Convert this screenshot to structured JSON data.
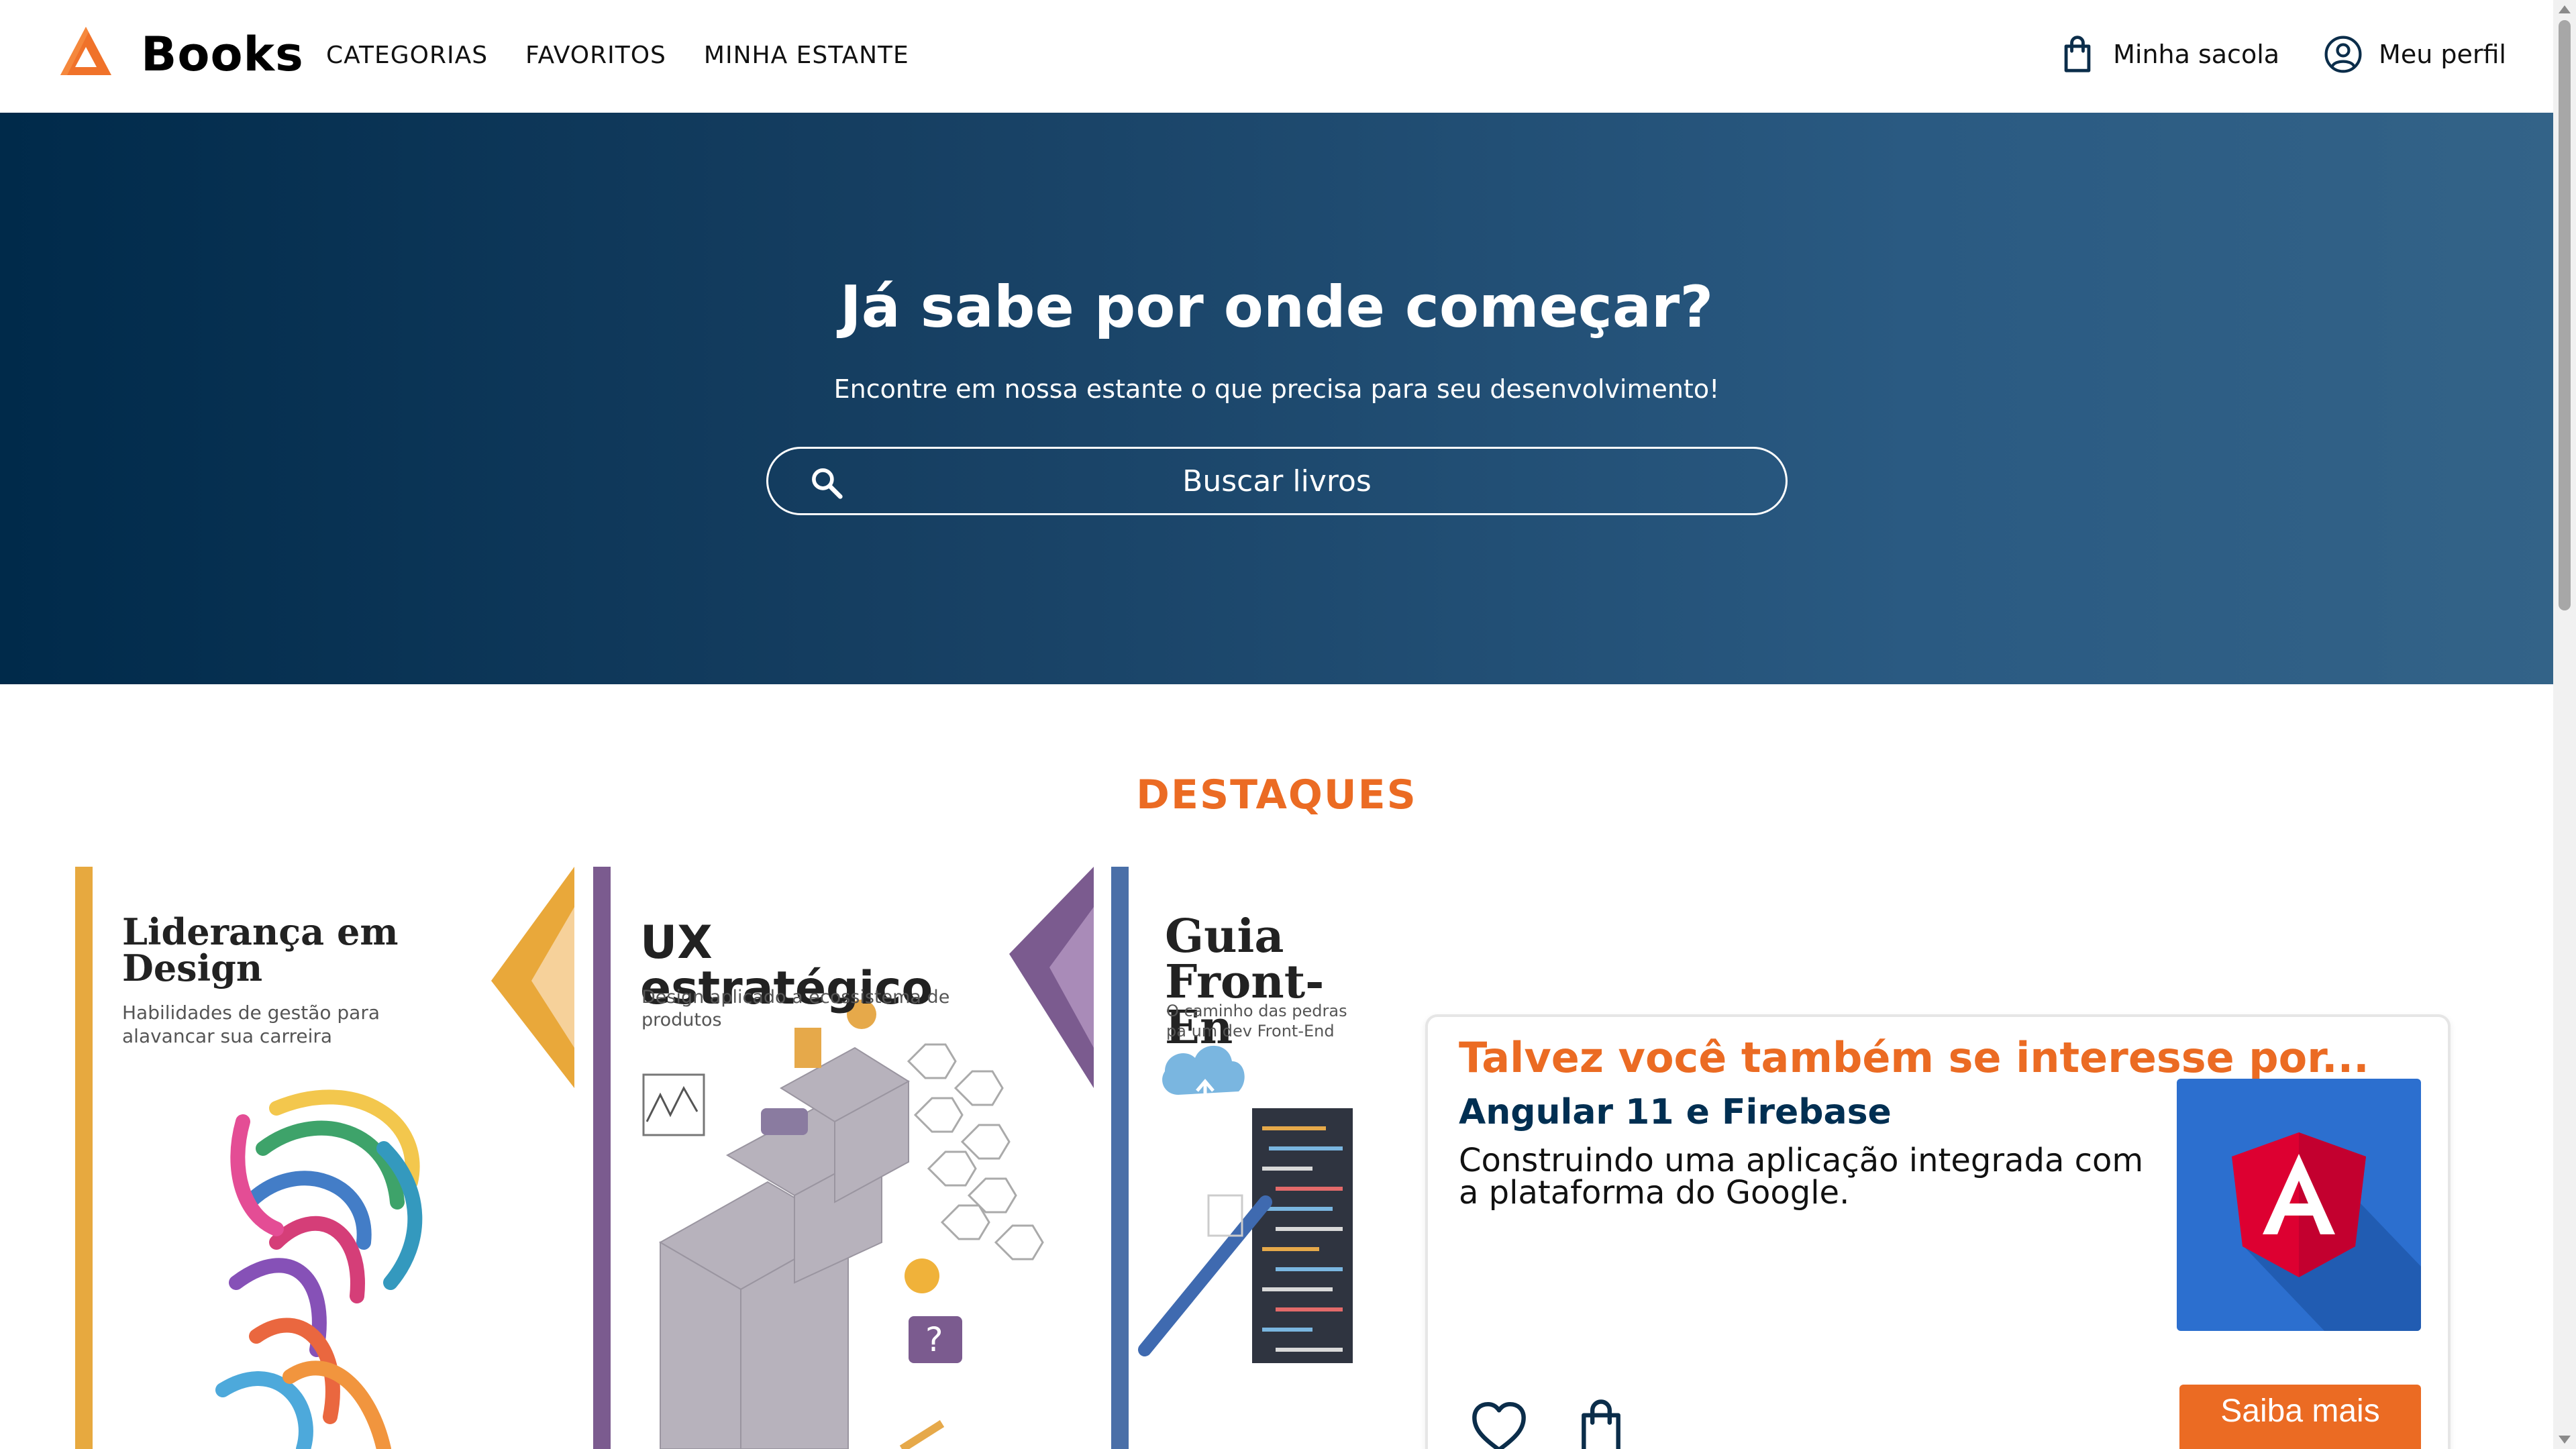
{
  "header": {
    "brand": "Books",
    "nav": [
      "CATEGORIAS",
      "FAVORITOS",
      "MINHA ESTANTE"
    ],
    "bag_label": "Minha sacola",
    "profile_label": "Meu perfil",
    "logo_icon": "triangle-logo-icon",
    "bag_icon": "shopping-bag-icon",
    "profile_icon": "user-circle-icon"
  },
  "hero": {
    "title": "Já sabe por onde começar?",
    "subtitle": "Encontre em nossa estante o que precisa para seu desenvolvimento!",
    "search_placeholder": "Buscar livros",
    "search_icon": "search-icon"
  },
  "destaques": {
    "title": "DESTAQUES",
    "books": [
      {
        "title": "Liderança em Design",
        "subtitle": "Habilidades de gestão para alavancar sua carreira"
      },
      {
        "title": "UX estratégico",
        "subtitle": "Design aplicado a ecossistema de produtos"
      },
      {
        "title": "Guia Front-En",
        "subtitle": "O caminho das pedras pa um dev Front-End"
      }
    ]
  },
  "recommendation": {
    "heading": "Talvez você também se interesse por...",
    "book_title": "Angular 11 e Firebase",
    "description": "Construindo uma aplicação integrada com a plataforma do Google.",
    "button": "Saiba mais",
    "favorite_icon": "heart-icon",
    "bag_icon": "shopping-bag-icon"
  },
  "colors": {
    "accent": "#eb6b23",
    "navy": "#002f52",
    "hero_start": "#002a4a",
    "hero_end": "#336388"
  }
}
